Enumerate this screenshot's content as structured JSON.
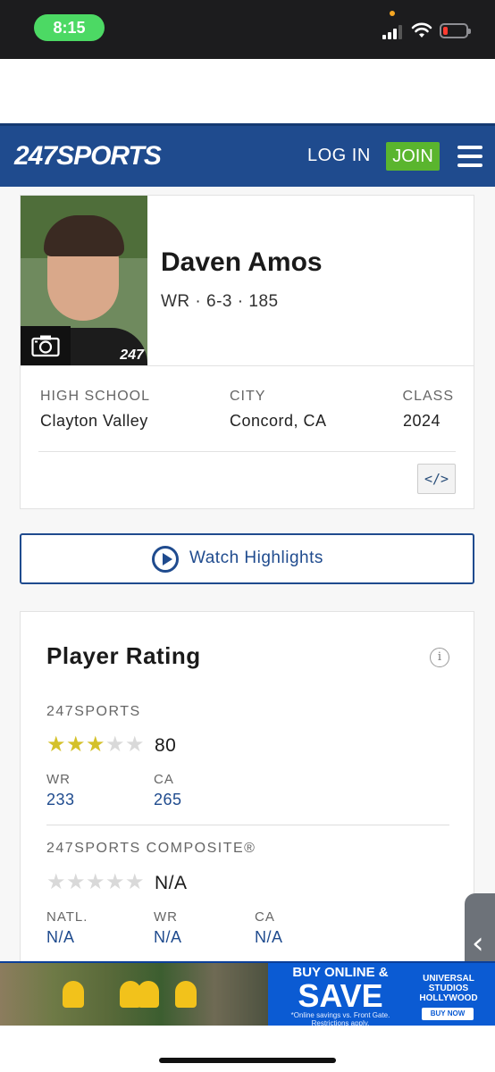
{
  "status_bar": {
    "time": "8:15"
  },
  "nav": {
    "logo_num": "247",
    "logo_word": "SPORTS",
    "login_label": "LOG IN",
    "join_label": "JOIN"
  },
  "player": {
    "name": "Daven Amos",
    "meta": "WR · 6-3 · 185",
    "photo_watermark": "247",
    "info": [
      {
        "label": "HIGH SCHOOL",
        "value": "Clayton Valley"
      },
      {
        "label": "CITY",
        "value": "Concord, CA"
      },
      {
        "label": "CLASS",
        "value": "2024"
      }
    ],
    "embed_label": "</>"
  },
  "highlights": {
    "label": "Watch Highlights"
  },
  "rating": {
    "title": "Player Rating",
    "info_icon": "i",
    "sports247": {
      "label": "247SPORTS",
      "stars_filled": 3,
      "stars_total": 5,
      "score": "80",
      "ranks": [
        {
          "label": "WR",
          "value": "233"
        },
        {
          "label": "CA",
          "value": "265"
        }
      ]
    },
    "composite": {
      "label": "247SPORTS COMPOSITE®",
      "stars_filled": 0,
      "stars_total": 5,
      "score": "N/A",
      "ranks": [
        {
          "label": "NATL.",
          "value": "N/A"
        },
        {
          "label": "WR",
          "value": "N/A"
        },
        {
          "label": "CA",
          "value": "N/A"
        }
      ]
    }
  },
  "ad": {
    "headline": "BUY ONLINE &",
    "save": "SAVE",
    "fine_print": "*Online savings vs. Front Gate. Restrictions apply.",
    "brand": "UNIVERSAL STUDIOS HOLLYWOOD",
    "cta": "BUY NOW"
  },
  "colors": {
    "nav_blue": "#1f4b8e",
    "join_green": "#5ab52e",
    "star_gold": "#d4c12a",
    "star_empty": "#d9d9d9",
    "rank_blue": "#1f4b8e",
    "ad_blue": "#0b5bd3"
  },
  "icons": {
    "camera": "camera-icon",
    "menu": "hamburger-menu-icon",
    "play": "play-circle-icon",
    "info": "info-icon",
    "side_chevron": "chevron-left-icon"
  }
}
